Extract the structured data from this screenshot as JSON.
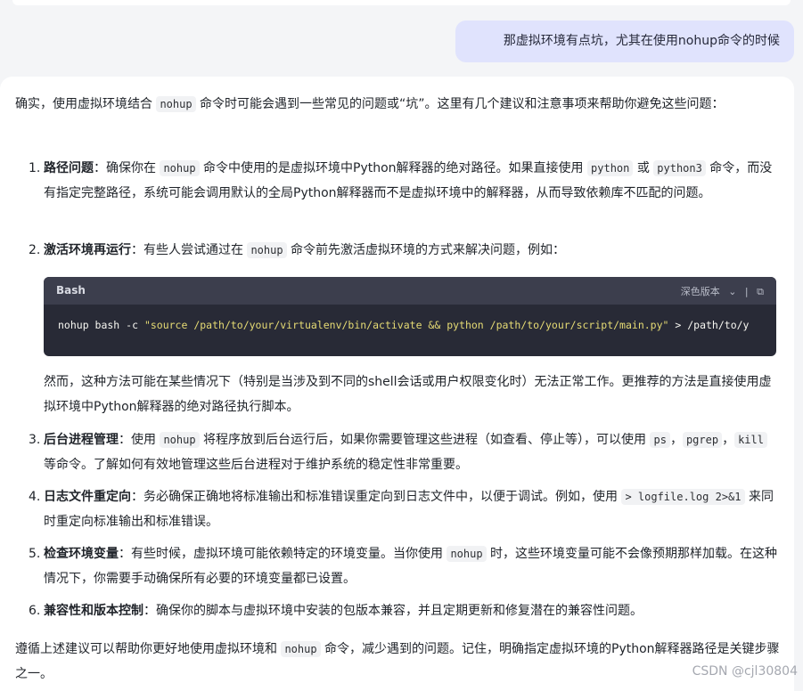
{
  "user_message": "那虚拟环境有点坑，尤其在使用nohup命令的时候",
  "intro": {
    "pre": "确实，使用虚拟环境结合 ",
    "code": "nohup",
    "post": " 命令时可能会遇到一些常见的问题或“坑”。这里有几个建议和注意事项来帮助你避免这些问题："
  },
  "items": [
    {
      "num": "1.",
      "title": "路径问题",
      "segments": [
        {
          "t": "：确保你在 "
        },
        {
          "c": "nohup"
        },
        {
          "t": " 命令中使用的是虚拟环境中Python解释器的绝对路径。如果直接使用 "
        },
        {
          "c": "python"
        },
        {
          "t": " 或 "
        },
        {
          "c": "python3"
        },
        {
          "t": " 命令，而没有指定完整路径，系统可能会调用默认的全局Python解释器而不是虚拟环境中的解释器，从而导致依赖库不匹配的问题。"
        }
      ]
    },
    {
      "num": "2.",
      "title": "激活环境再运行",
      "segments": [
        {
          "t": "：有些人尝试通过在 "
        },
        {
          "c": "nohup"
        },
        {
          "t": " 命令前先激活虚拟环境的方式来解决问题，例如："
        }
      ]
    },
    {
      "num": "3.",
      "title": "后台进程管理",
      "segments": [
        {
          "t": "：使用 "
        },
        {
          "c": "nohup"
        },
        {
          "t": " 将程序放到后台运行后，如果你需要管理这些进程（如查看、停止等），可以使用 "
        },
        {
          "c": "ps"
        },
        {
          "t": "，"
        },
        {
          "c": "pgrep"
        },
        {
          "t": "，"
        },
        {
          "c": "kill"
        },
        {
          "t": " 等命令。了解如何有效地管理这些后台进程对于维护系统的稳定性非常重要。"
        }
      ]
    },
    {
      "num": "4.",
      "title": "日志文件重定向",
      "segments": [
        {
          "t": "：务必确保正确地将标准输出和标准错误重定向到日志文件中，以便于调试。例如，使用 "
        },
        {
          "c": "> logfile.log 2>&1"
        },
        {
          "t": " 来同时重定向标准输出和标准错误。"
        }
      ]
    },
    {
      "num": "5.",
      "title": "检查环境变量",
      "segments": [
        {
          "t": "：有些时候，虚拟环境可能依赖特定的环境变量。当你使用 "
        },
        {
          "c": "nohup"
        },
        {
          "t": " 时，这些环境变量可能不会像预期那样加载。在这种情况下，你需要手动确保所有必要的环境变量都已设置。"
        }
      ]
    },
    {
      "num": "6.",
      "title": "兼容性和版本控制",
      "segments": [
        {
          "t": "：确保你的脚本与虚拟环境中安装的包版本兼容，并且定期更新和修复潜在的兼容性问题。"
        }
      ]
    }
  ],
  "code_block": {
    "lang": "Bash",
    "theme_label": "深色版本",
    "cmd_pre": "nohup bash -c ",
    "cmd_str": "\"source /path/to/your/virtualenv/bin/activate && python /path/to/your/script/main.py\"",
    "cmd_post": " > /path/to/y"
  },
  "after_code": "然而，这种方法可能在某些情况下（特别是当涉及到不同的shell会话或用户权限变化时）无法正常工作。更推荐的方法是直接使用虚拟环境中Python解释器的绝对路径执行脚本。",
  "conclusion": {
    "pre": "遵循上述建议可以帮助你更好地使用虚拟环境和 ",
    "code": "nohup",
    "post": " 命令，减少遇到的问题。记住，明确指定虚拟环境的Python解释器路径是关键步骤之一。"
  },
  "watermark": "CSDN @cjl30804"
}
